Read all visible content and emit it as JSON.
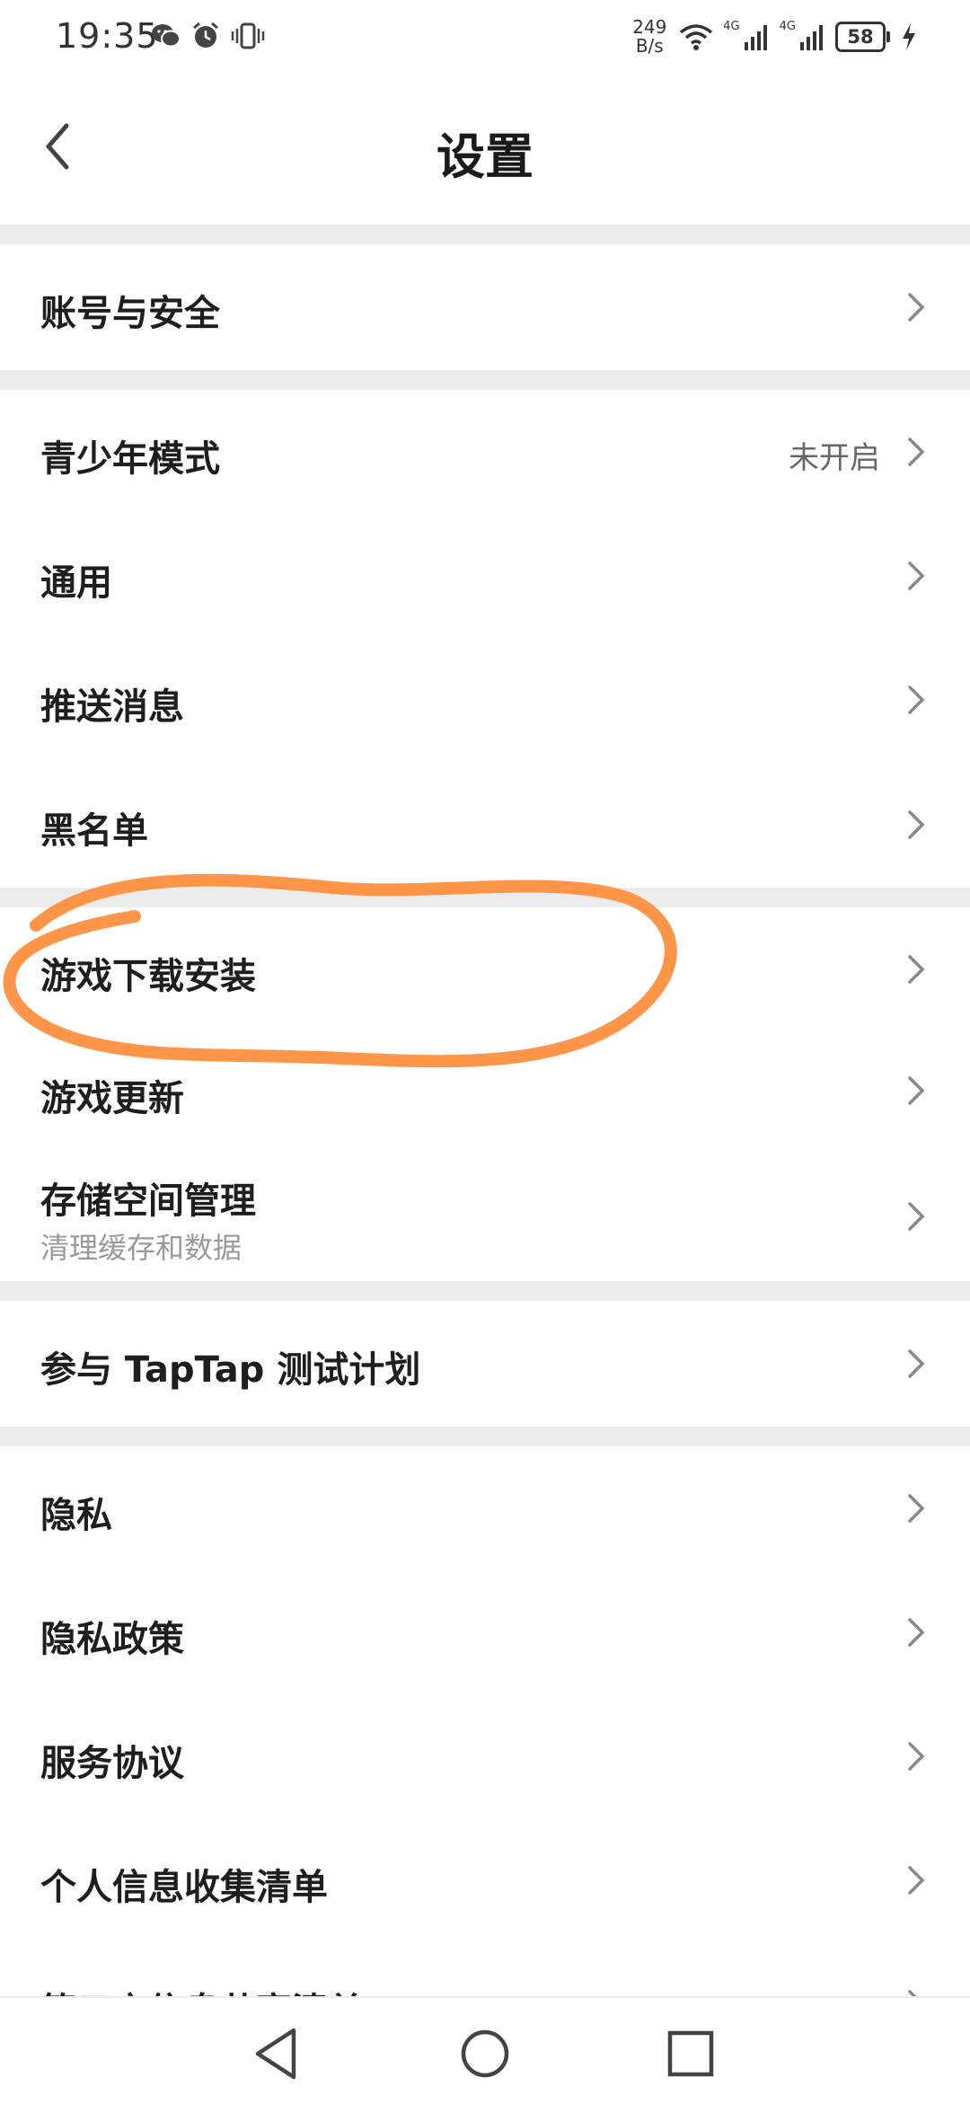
{
  "status_bar": {
    "time": "19:35",
    "net_speed_value": "249",
    "net_speed_unit": "B/s",
    "signal1_label": "4G",
    "signal2_label": "4G",
    "battery": "58"
  },
  "header": {
    "title": "设置"
  },
  "settings": {
    "account_security": "账号与安全",
    "youth_mode": "青少年模式",
    "youth_mode_status": "未开启",
    "general": "通用",
    "push_messages": "推送消息",
    "blacklist": "黑名单",
    "game_download_install": "游戏下载安装",
    "game_update": "游戏更新",
    "storage_management": "存储空间管理",
    "storage_management_sub": "清理缓存和数据",
    "taptap_test_plan": "参与 TapTap 测试计划",
    "privacy": "隐私",
    "privacy_policy": "隐私政策",
    "service_agreement": "服务协议",
    "personal_info_list": "个人信息收集清单",
    "third_party_sharing_list": "第三方信息共享清单"
  },
  "colors": {
    "annotation_stroke": "#FF8C3A",
    "section_gap": "#ECECEC"
  },
  "icons": {
    "back": "chevron-left-icon",
    "row_arrow": "chevron-right-icon",
    "nav_back": "triangle-back-icon",
    "nav_home": "circle-home-icon",
    "nav_recents": "square-recents-icon"
  }
}
